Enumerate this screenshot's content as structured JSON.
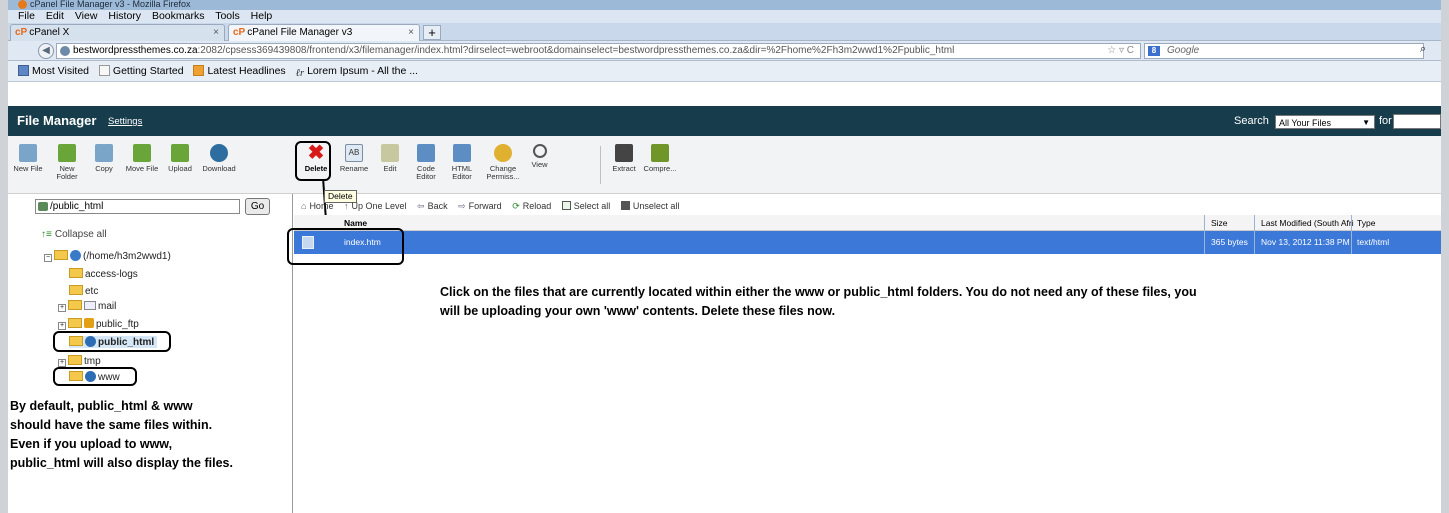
{
  "browser": {
    "window_title": "cPanel File Manager v3 - Mozilla Firefox",
    "menu": [
      "File",
      "Edit",
      "View",
      "History",
      "Bookmarks",
      "Tools",
      "Help"
    ],
    "tabs": [
      {
        "label": "cPanel X"
      },
      {
        "label": "cPanel File Manager v3"
      }
    ],
    "url_domain": "bestwordpressthemes.co.za",
    "url_rest": ":2082/cpsess369439808/frontend/x3/filemanager/index.html?dirselect=webroot&domainselect=bestwordpressthemes.co.za&dir=%2Fhome%2Fh3m2wwd1%2Fpublic_html",
    "search_engine": "Google",
    "bookmarks": [
      "Most Visited",
      "Getting Started",
      "Latest Headlines",
      "Lorem Ipsum - All the ..."
    ]
  },
  "header": {
    "title": "File Manager",
    "settings": "Settings",
    "search_label": "Search",
    "search_scope": "All Your Files",
    "for_label": "for"
  },
  "toolbar": [
    {
      "id": "new-file",
      "label": "New File",
      "icon": "new-file-icon"
    },
    {
      "id": "new-folder",
      "label": "New Folder",
      "icon": "new-folder-icon"
    },
    {
      "id": "copy",
      "label": "Copy",
      "icon": "copy-icon"
    },
    {
      "id": "move-file",
      "label": "Move File",
      "icon": "move-file-icon"
    },
    {
      "id": "upload",
      "label": "Upload",
      "icon": "upload-icon"
    },
    {
      "id": "download",
      "label": "Download",
      "icon": "download-icon"
    },
    {
      "id": "delete",
      "label": "Delete",
      "icon": "delete-icon"
    },
    {
      "id": "rename",
      "label": "Rename",
      "icon": "rename-icon"
    },
    {
      "id": "edit",
      "label": "Edit",
      "icon": "edit-icon"
    },
    {
      "id": "code-editor",
      "label": "Code Editor",
      "icon": "code-editor-icon"
    },
    {
      "id": "html-editor",
      "label": "HTML Editor",
      "icon": "html-editor-icon"
    },
    {
      "id": "change-permissions",
      "label": "Change Permiss...",
      "icon": "key-icon"
    },
    {
      "id": "view",
      "label": "View",
      "icon": "magnifier-icon"
    },
    {
      "id": "extract",
      "label": "Extract",
      "icon": "extract-icon"
    },
    {
      "id": "compress",
      "label": "Compre...",
      "icon": "compress-icon"
    }
  ],
  "tooltip": "Delete",
  "sidebar": {
    "path_value": "/public_html",
    "go_label": "Go",
    "collapse_label": "Collapse all",
    "tree": [
      {
        "label": "(/home/h3m2wwd1)"
      },
      {
        "label": "access-logs"
      },
      {
        "label": "etc"
      },
      {
        "label": "mail"
      },
      {
        "label": "public_ftp"
      },
      {
        "label": "public_html"
      },
      {
        "label": "tmp"
      },
      {
        "label": "www"
      }
    ]
  },
  "nav": {
    "home": "Home",
    "up": "Up One Level",
    "back": "Back",
    "forward": "Forward",
    "reload": "Reload",
    "select_all": "Select all",
    "unselect_all": "Unselect all"
  },
  "table": {
    "headers": {
      "name": "Name",
      "size": "Size",
      "modified": "Last Modified (South Afri",
      "type": "Type"
    },
    "rows": [
      {
        "name": "index.htm",
        "size": "365 bytes",
        "modified": "Nov 13, 2012 11:38 PM",
        "type": "text/html"
      }
    ]
  },
  "notes": {
    "main_line1": "Click on the files that are currently located within either the www or public_html folders. You do not need any of these files, you",
    "main_line2": "will be uploading your own 'www' contents. Delete these files now.",
    "left": [
      "By default, public_html & www",
      "should have the same files within.",
      "Even if you upload to www,",
      "public_html will also display the files."
    ]
  }
}
